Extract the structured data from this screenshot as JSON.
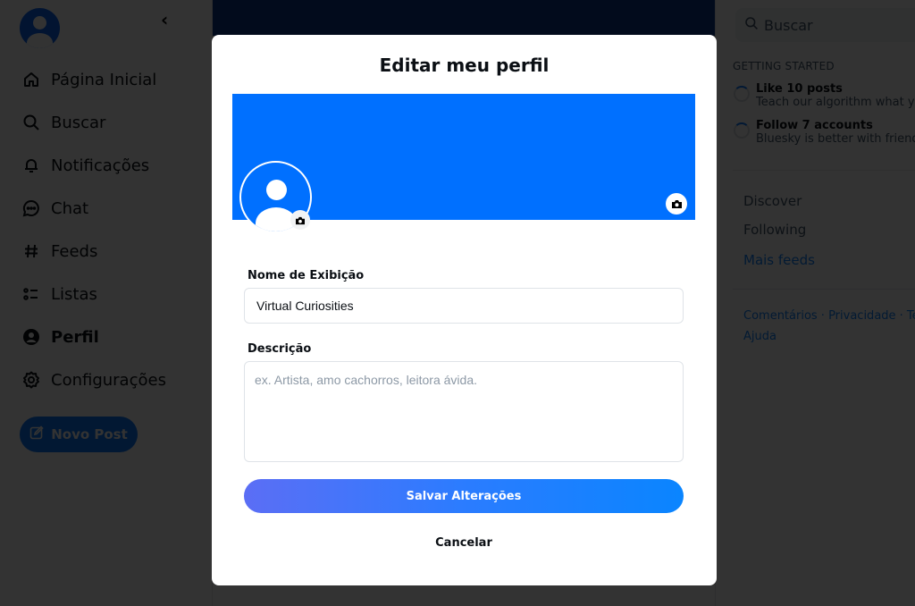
{
  "left_nav": {
    "collapse_glyph": "‹",
    "items": [
      {
        "label": "Página Inicial",
        "icon": "home-icon"
      },
      {
        "label": "Buscar",
        "icon": "search-icon"
      },
      {
        "label": "Notificações",
        "icon": "bell-icon"
      },
      {
        "label": "Chat",
        "icon": "chat-icon"
      },
      {
        "label": "Feeds",
        "icon": "hash-icon"
      },
      {
        "label": "Listas",
        "icon": "list-icon"
      },
      {
        "label": "Perfil",
        "icon": "user-circle-icon",
        "active": true
      },
      {
        "label": "Configurações",
        "icon": "gear-icon"
      }
    ],
    "new_post_label": "Novo Post"
  },
  "right_sidebar": {
    "search_placeholder": "Buscar",
    "getting_started": {
      "title": "GETTING STARTED",
      "items": [
        {
          "title": "Like 10 posts",
          "subtitle": "Teach our algorithm what you like"
        },
        {
          "title": "Follow 7 accounts",
          "subtitle": "Bluesky is better with friends!"
        }
      ]
    },
    "feeds": [
      "Discover",
      "Following"
    ],
    "more_feeds_label": "Mais feeds",
    "footer_line1": "Comentários · Privacidade · Termos",
    "footer_line2": "Ajuda"
  },
  "modal": {
    "title": "Editar meu perfil",
    "display_name_label": "Nome de Exibição",
    "display_name_value": "Virtual Curiosities",
    "description_label": "Descrição",
    "description_placeholder": "ex. Artista, amo cachorros, leitora ávida.",
    "description_value": "",
    "save_label": "Salvar Alterações",
    "cancel_label": "Cancelar",
    "colors": {
      "cover": "#0070ff",
      "save_gradient_start": "#5b6ef5",
      "save_gradient_end": "#0a85ff"
    }
  }
}
